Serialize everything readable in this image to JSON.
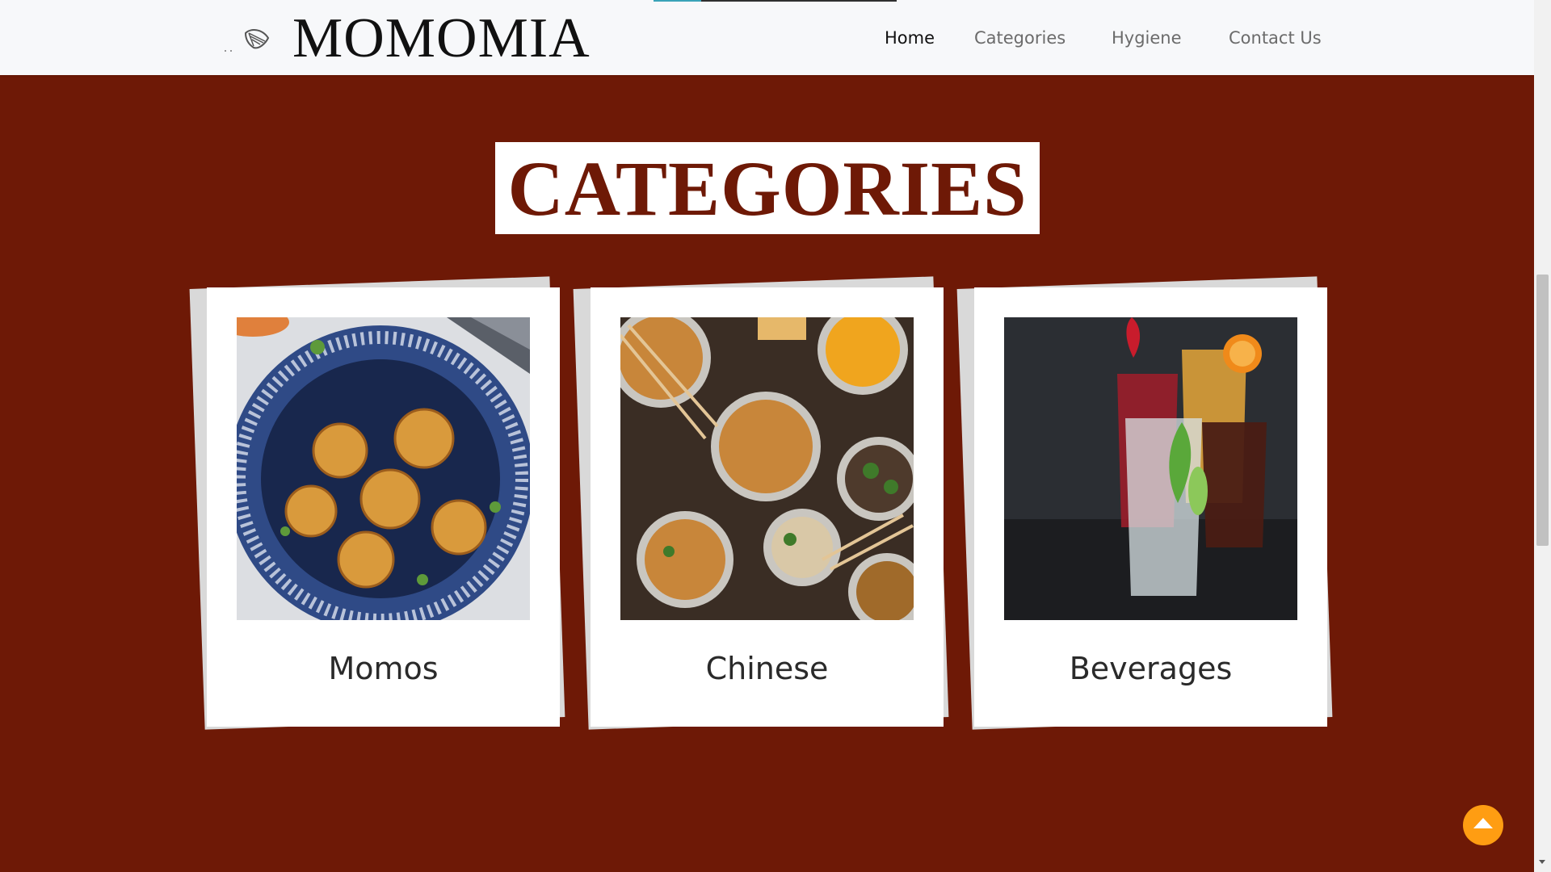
{
  "brand": {
    "name": "MOMOMIA",
    "icon": "shell-logo-icon"
  },
  "nav": {
    "items": [
      {
        "label": "Home",
        "active": true
      },
      {
        "label": "Categories",
        "active": false
      },
      {
        "label": "Hygiene",
        "active": false
      },
      {
        "label": "Contact Us",
        "active": false
      }
    ]
  },
  "section": {
    "title": "CATEGORIES",
    "cards": [
      {
        "label": "Momos",
        "image": "momos-photo"
      },
      {
        "label": "Chinese",
        "image": "chinese-food-photo"
      },
      {
        "label": "Beverages",
        "image": "beverages-photo"
      }
    ]
  },
  "back_to_top": {
    "icon": "arrow-up-icon"
  },
  "colors": {
    "section_background": "#6e1906",
    "navbar_background": "#f7f8fa",
    "accent": "#ff9d12",
    "card_background": "#ffffff"
  }
}
